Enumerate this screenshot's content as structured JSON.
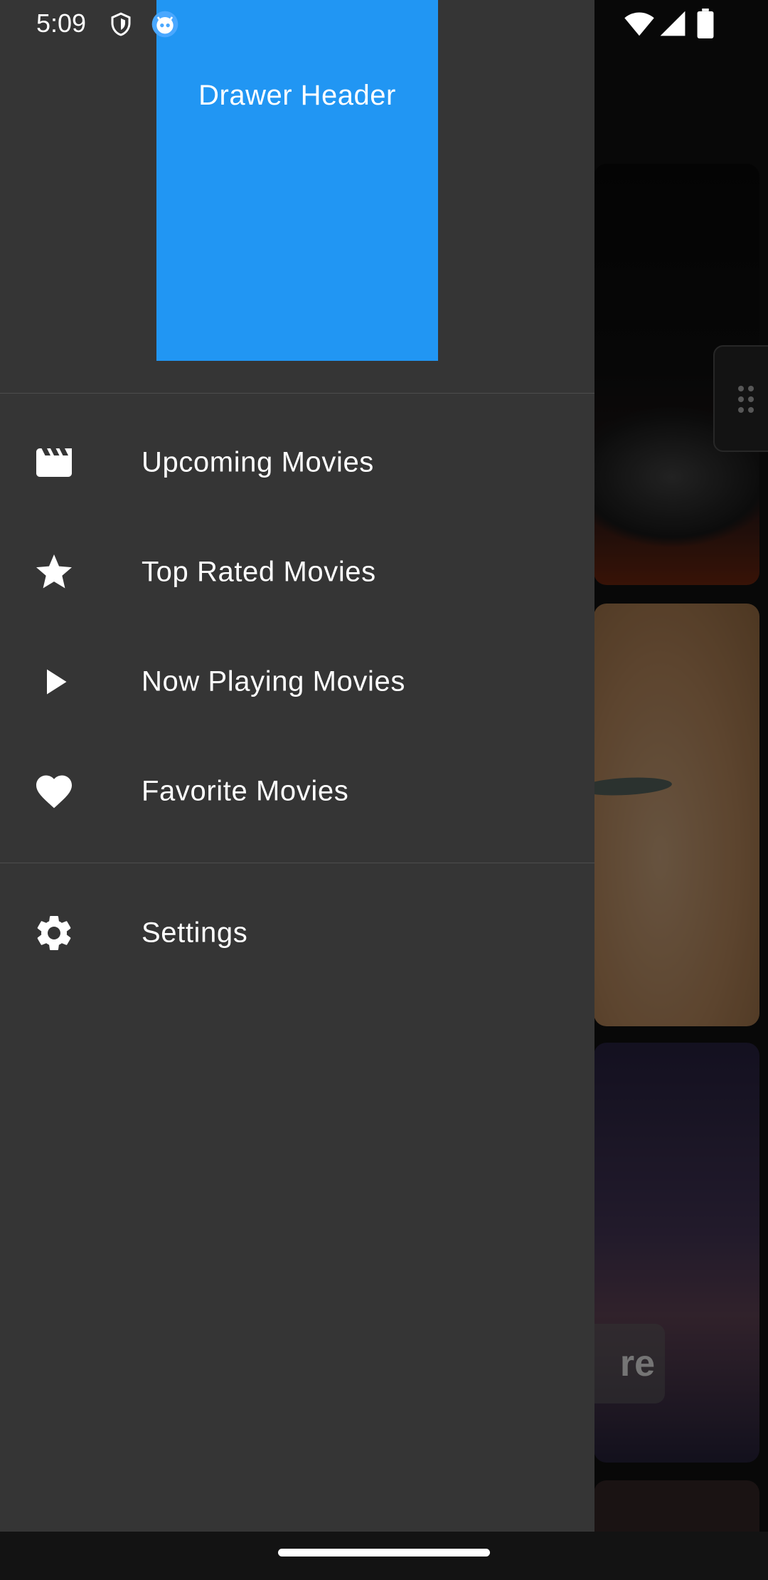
{
  "status_bar": {
    "time": "5:09",
    "icons": [
      "shield-icon",
      "bot-icon",
      "wifi-icon",
      "signal-icon",
      "battery-icon"
    ]
  },
  "drawer": {
    "header_title": "Drawer Header",
    "header_color": "#2196f3",
    "background_color": "#353535",
    "items": [
      {
        "label": "Upcoming Movies",
        "icon": "clapperboard-icon"
      },
      {
        "label": "Top Rated Movies",
        "icon": "star-icon"
      },
      {
        "label": "Now Playing Movies",
        "icon": "play-icon"
      },
      {
        "label": "Favorite Movies",
        "icon": "heart-icon"
      }
    ],
    "secondary_items": [
      {
        "label": "Settings",
        "icon": "gear-icon"
      }
    ]
  },
  "background": {
    "partial_card_text": "re"
  }
}
